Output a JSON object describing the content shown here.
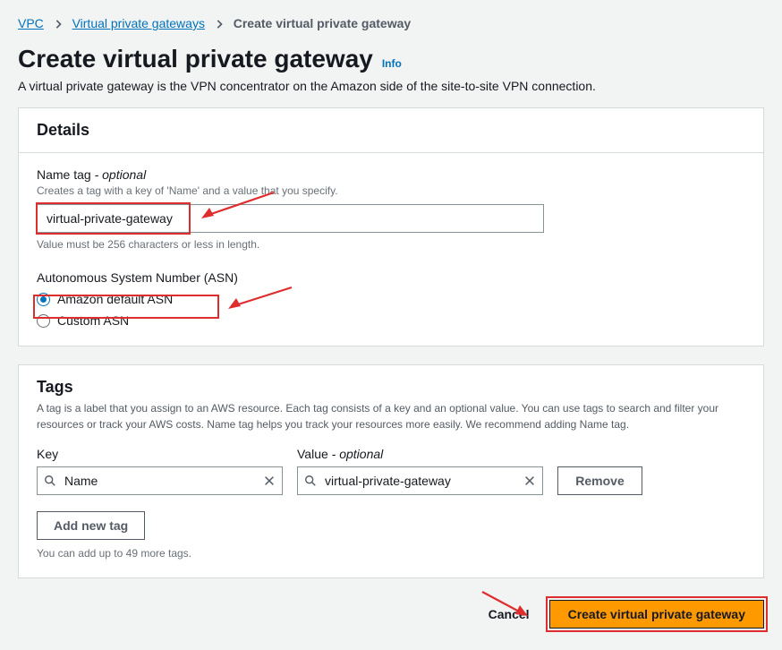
{
  "breadcrumb": {
    "vpc": "VPC",
    "vpg": "Virtual private gateways",
    "current": "Create virtual private gateway"
  },
  "header": {
    "title": "Create virtual private gateway",
    "info": "Info",
    "description": "A virtual private gateway is the VPN concentrator on the Amazon side of the site-to-site VPN connection."
  },
  "details": {
    "title": "Details",
    "name_tag": {
      "label": "Name tag",
      "optional_suffix": " - optional",
      "hint": "Creates a tag with a key of 'Name' and a value that you specify.",
      "value": "virtual-private-gateway",
      "validation": "Value must be 256 characters or less in length."
    },
    "asn": {
      "label": "Autonomous System Number (ASN)",
      "option_default": "Amazon default ASN",
      "option_custom": "Custom ASN"
    }
  },
  "tags": {
    "title": "Tags",
    "description": "A tag is a label that you assign to an AWS resource. Each tag consists of a key and an optional value. You can use tags to search and filter your resources or track your AWS costs. Name tag helps you track your resources more easily. We recommend adding Name tag.",
    "key_label": "Key",
    "value_label": "Value",
    "value_optional_suffix": " - optional",
    "row": {
      "key": "Name",
      "value": "virtual-private-gateway"
    },
    "remove_label": "Remove",
    "add_label": "Add new tag",
    "limit_hint": "You can add up to 49 more tags."
  },
  "footer": {
    "cancel": "Cancel",
    "submit": "Create virtual private gateway"
  }
}
